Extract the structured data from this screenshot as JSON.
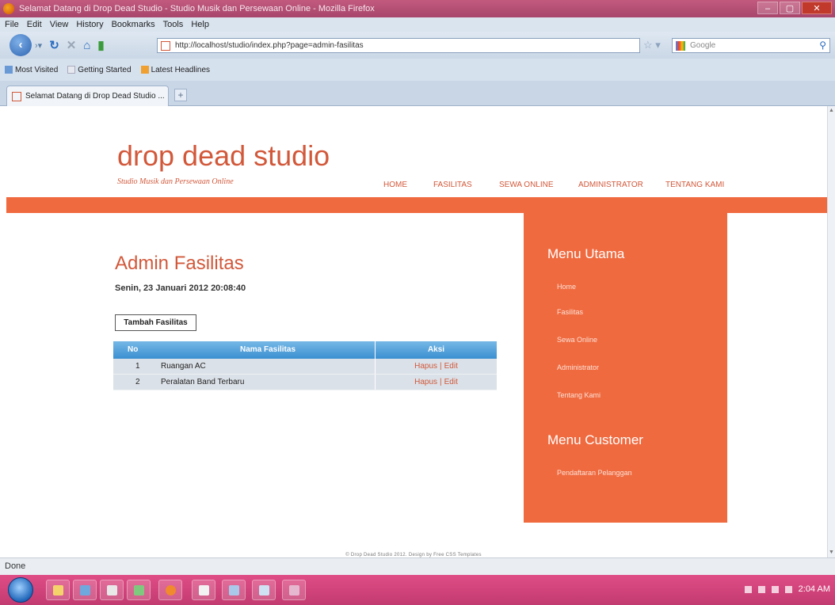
{
  "window": {
    "title": "Selamat Datang di Drop Dead Studio - Studio Musik dan Persewaan Online - Mozilla Firefox",
    "controls": {
      "minimize": "‒",
      "maximize": "▢",
      "close": "✕"
    }
  },
  "menubar": [
    "File",
    "Edit",
    "View",
    "History",
    "Bookmarks",
    "Tools",
    "Help"
  ],
  "toolbar": {
    "url": "http://localhost/studio/index.php?page=admin-fasilitas",
    "search_placeholder": "Google"
  },
  "bookmarks": [
    "Most Visited",
    "Getting Started",
    "Latest Headlines"
  ],
  "tabs": [
    {
      "label": "Selamat Datang di Drop Dead Studio ..."
    }
  ],
  "site": {
    "logo": "drop dead studio",
    "tagline": "Studio Musik dan Persewaan Online",
    "nav": [
      "HOME",
      "FASILITAS",
      "SEWA ONLINE",
      "ADMINISTRATOR",
      "TENTANG KAMI"
    ]
  },
  "main": {
    "title": "Admin Fasilitas",
    "date": "Senin, 23 Januari 2012 20:08:40",
    "add_button": "Tambah Fasilitas"
  },
  "table": {
    "headers": [
      "No",
      "Nama Fasilitas",
      "Aksi"
    ],
    "rows": [
      {
        "no": "1",
        "name": "Ruangan AC",
        "hapus": "Hapus",
        "sep": "|",
        "edit": "Edit"
      },
      {
        "no": "2",
        "name": "Peralatan Band Terbaru",
        "hapus": "Hapus",
        "sep": "|",
        "edit": "Edit"
      }
    ]
  },
  "sidebar": {
    "menu_utama": {
      "title": "Menu Utama",
      "items": [
        "Home",
        "Fasilitas",
        "Sewa Online",
        "Administrator",
        "Tentang Kami"
      ]
    },
    "menu_customer": {
      "title": "Menu Customer",
      "items": [
        "Pendaftaran Pelanggan"
      ]
    }
  },
  "footer": "© Drop Dead Studio 2012. Design by Free CSS Templates",
  "statusbar": {
    "text": "Done"
  },
  "taskbar": {
    "clock": "2:04 AM"
  },
  "colors": {
    "accent": "#f06a3f",
    "text_accent": "#d2583a",
    "table_header": "#3a8fd1"
  }
}
